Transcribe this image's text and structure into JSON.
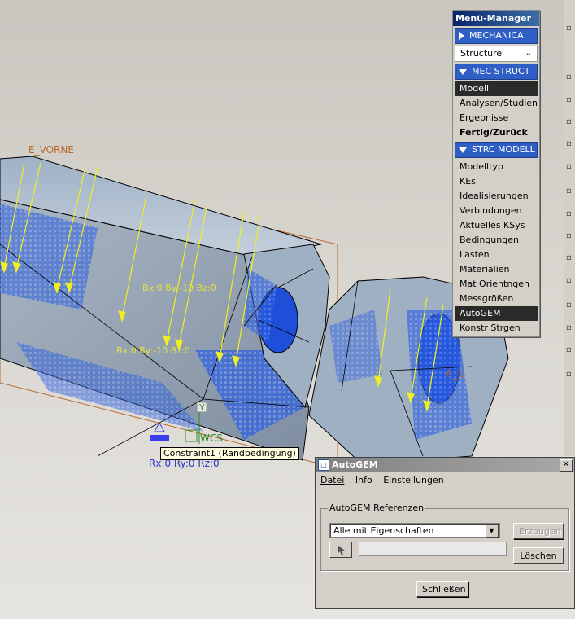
{
  "viewport": {
    "datum_label": "E_VORNE",
    "load_labels": [
      "Bx:0 By:-10 Bz:0",
      "Bx:0 By:-10 Bz:0"
    ],
    "csys_label": "WCS",
    "y_axis_label": "Y",
    "a1_label": "A_1",
    "constraint_text": "Rx:0 Ry:0 Rz:0",
    "tooltip": "Constraint1 (Randbedingung)",
    "colors": {
      "surface": "#aab8c8",
      "mesh_blue": "#1a4fd8",
      "load_arrow": "#f0f020",
      "datum": "#b86a2a"
    }
  },
  "menu_manager": {
    "title": "Menü-Manager",
    "section1": "MECHANICA",
    "dropdown_value": "Structure",
    "section2": "MEC STRUCT",
    "mec_items": [
      {
        "label": "Modell",
        "selected": true
      },
      {
        "label": "Analysen/Studien"
      },
      {
        "label": "Ergebnisse"
      },
      {
        "label": "Fertig/Zurück",
        "bold": true
      }
    ],
    "section3": "STRC MODELL",
    "strc_items": [
      {
        "label": "Modelltyp"
      },
      {
        "label": "KEs"
      },
      {
        "label": "Idealisierungen"
      },
      {
        "label": "Verbindungen"
      },
      {
        "label": "Aktuelles KSys"
      },
      {
        "label": "Bedingungen"
      },
      {
        "label": "Lasten"
      },
      {
        "label": "Materialien"
      },
      {
        "label": "Mat Orientngen"
      },
      {
        "label": "Messgrößen"
      },
      {
        "label": "AutoGEM",
        "selected": true
      },
      {
        "label": "Konstr Strgen"
      }
    ]
  },
  "dialog": {
    "title": "AutoGEM",
    "menu": [
      "Datei",
      "Info",
      "Einstellungen"
    ],
    "group_label": "AutoGEM Referenzen",
    "combo_value": "Alle mit Eigenschaften",
    "create_button": "Erzeugen",
    "delete_button": "Löschen",
    "close_button": "Schließen"
  }
}
